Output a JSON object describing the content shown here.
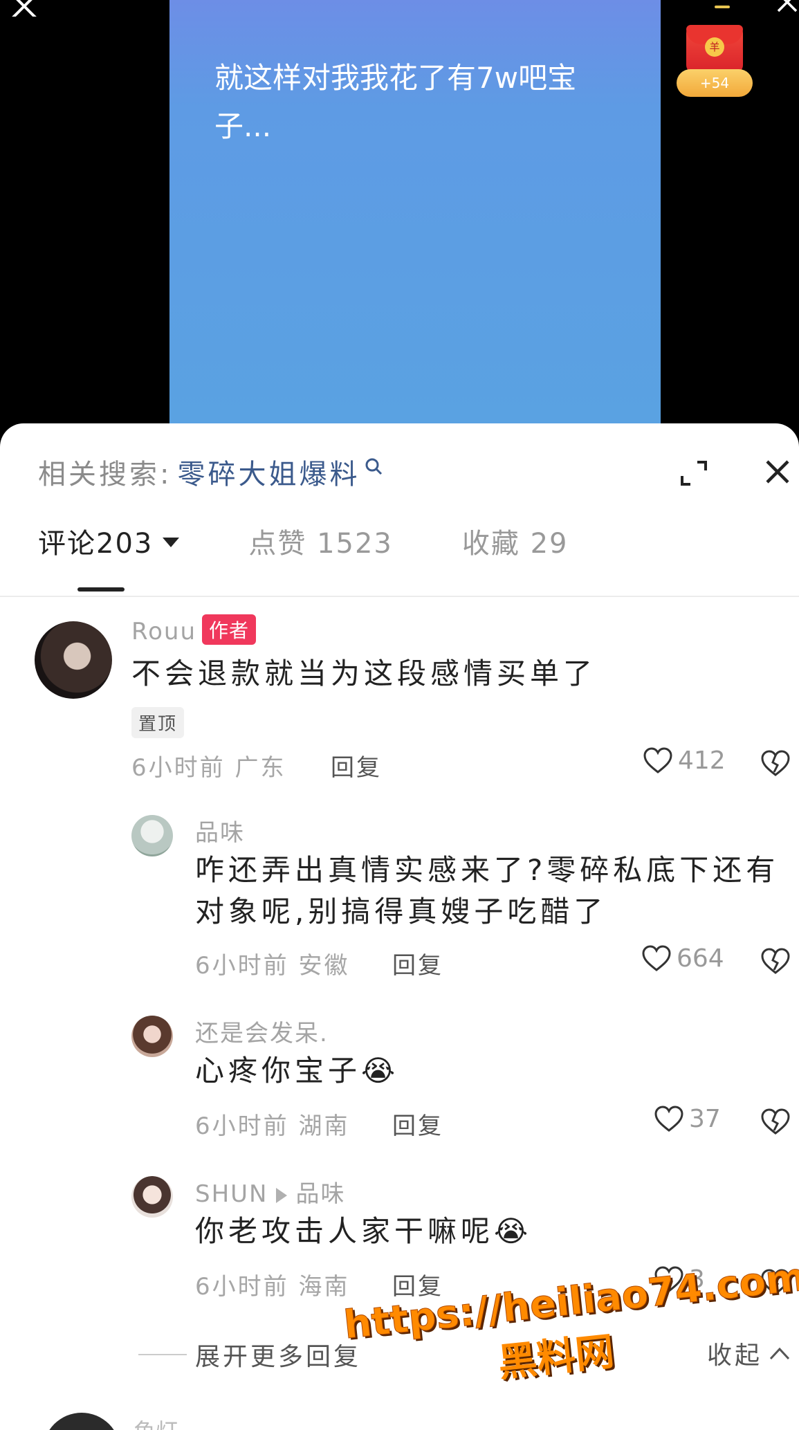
{
  "video": {
    "caption": "就这样对我我花了有7w吧宝子...",
    "redpacket_char": "羊",
    "redpacket_reward": "+54"
  },
  "sheet": {
    "related_label": "相关搜索:",
    "related_keyword": "零碎大姐爆料",
    "tabs": [
      {
        "label": "评论203",
        "active": true
      },
      {
        "label": "点赞 1523",
        "active": false
      },
      {
        "label": "收藏 29",
        "active": false
      }
    ]
  },
  "comments": [
    {
      "user": "Rouu",
      "badge": "作者",
      "text": "不会退款就当为这段感情买单了",
      "pin": "置顶",
      "meta": "6小时前 广东",
      "reply": "回复",
      "likes": "412"
    },
    {
      "user": "品味",
      "text_line1": "咋还弄出真情实感来了?零碎私底下还有",
      "text_line2": "对象呢,别搞得真嫂子吃醋了",
      "meta": "6小时前 安徽",
      "reply": "回复",
      "likes": "664"
    },
    {
      "user": "还是会发呆.",
      "text": "心疼你宝子",
      "emoji": "😭",
      "meta": "6小时前 湖南",
      "reply": "回复",
      "likes": "37"
    },
    {
      "user": "SHUN",
      "reply_to": "品味",
      "text": "你老攻击人家干嘛呢",
      "emoji": "😭",
      "meta": "6小时前 海南",
      "reply": "回复",
      "likes": "3"
    }
  ],
  "expand_more": "展开更多回复",
  "collapse": "收起",
  "watermark": {
    "url": "https://heiliao74.com",
    "name": "黑料网"
  },
  "next_comment_user": "鱼灯"
}
